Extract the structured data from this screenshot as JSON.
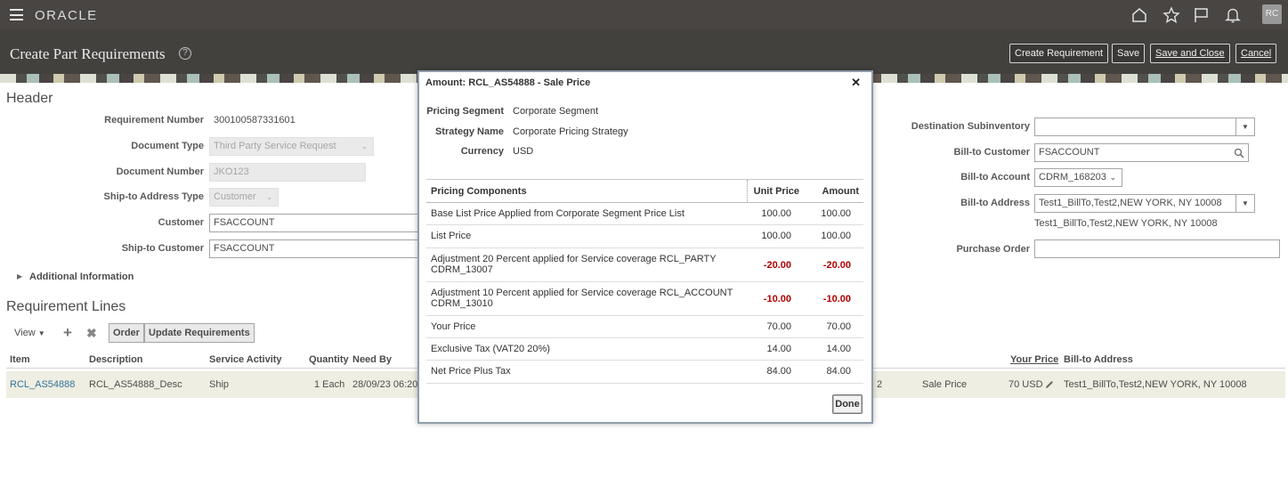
{
  "global": {
    "brand": "ORACLE",
    "avatar_initials": "RC"
  },
  "page": {
    "title": "Create Part Requirements",
    "help": "?",
    "buttons": {
      "create_requirement": "Create Requirement",
      "save": "Save",
      "save_and_close": "Save and Close",
      "cancel": "Cancel"
    }
  },
  "header": {
    "section_title": "Header",
    "requirement_number_label": "Requirement Number",
    "requirement_number": "300100587331601",
    "document_type_label": "Document Type",
    "document_type": "Third Party Service Request",
    "document_number_label": "Document Number",
    "document_number": "JKO123",
    "ship_to_address_type_label": "Ship-to Address Type",
    "ship_to_address_type": "Customer",
    "customer_label": "Customer",
    "customer": "FSACCOUNT",
    "ship_to_customer_label": "Ship-to Customer",
    "ship_to_customer": "FSACCOUNT",
    "destination_subinventory_label": "Destination Subinventory",
    "destination_subinventory": "",
    "bill_to_customer_label": "Bill-to Customer",
    "bill_to_customer": "FSACCOUNT",
    "bill_to_account_label": "Bill-to Account",
    "bill_to_account": "CDRM_168203",
    "bill_to_address_label": "Bill-to Address",
    "bill_to_address": "Test1_BillTo,Test2,NEW YORK, NY 10008",
    "bill_to_address_text": "Test1_BillTo,Test2,NEW YORK, NY 10008",
    "purchase_order_label": "Purchase Order",
    "purchase_order": "",
    "additional_information": "Additional Information"
  },
  "requirement_lines": {
    "section_title": "Requirement Lines",
    "view_label": "View",
    "order_button": "Order",
    "update_button": "Update Requirements",
    "columns": {
      "item": "Item",
      "description": "Description",
      "service_activity": "Service Activity",
      "quantity": "Quantity",
      "need_by": "Need By",
      "your_price": "Your Price",
      "bill_to_address": "Bill-to Address"
    },
    "row": {
      "item": "RCL_AS54888",
      "description": "RCL_AS54888_Desc",
      "service_activity": "Ship",
      "quantity": "1 Each",
      "need_by": "28/09/23 06:20",
      "hidden_col": "2",
      "price_type": "Sale Price",
      "your_price": "70 USD",
      "bill_to_address": "Test1_BillTo,Test2,NEW YORK, NY 10008"
    }
  },
  "modal": {
    "title": "Amount: RCL_AS54888 - Sale Price",
    "pricing_segment_label": "Pricing Segment",
    "pricing_segment": "Corporate Segment",
    "strategy_name_label": "Strategy Name",
    "strategy_name": "Corporate Pricing Strategy",
    "currency_label": "Currency",
    "currency": "USD",
    "table_headers": {
      "components": "Pricing Components",
      "unit_price": "Unit Price",
      "amount": "Amount"
    },
    "rows": [
      {
        "name": "Base List Price Applied from Corporate Segment Price List",
        "unit": "100.00",
        "amount": "100.00",
        "negative": false
      },
      {
        "name": "List Price",
        "unit": "100.00",
        "amount": "100.00",
        "negative": false
      },
      {
        "name": "Adjustment 20 Percent applied for Service coverage RCL_PARTY CDRM_13007",
        "unit": "-20.00",
        "amount": "-20.00",
        "negative": true
      },
      {
        "name": "Adjustment 10 Percent applied for Service coverage RCL_ACCOUNT CDRM_13010",
        "unit": "-10.00",
        "amount": "-10.00",
        "negative": true
      },
      {
        "name": "Your Price",
        "unit": "70.00",
        "amount": "70.00",
        "negative": false
      },
      {
        "name": "Exclusive Tax (VAT20 20%)",
        "unit": "14.00",
        "amount": "14.00",
        "negative": false
      },
      {
        "name": "Net Price Plus Tax",
        "unit": "84.00",
        "amount": "84.00",
        "negative": false
      }
    ],
    "done": "Done"
  },
  "colors": {
    "topbar": "#2f2c2a",
    "negative": "#b00000",
    "link": "#1a5e8a",
    "row_highlight": "#ececdf"
  }
}
